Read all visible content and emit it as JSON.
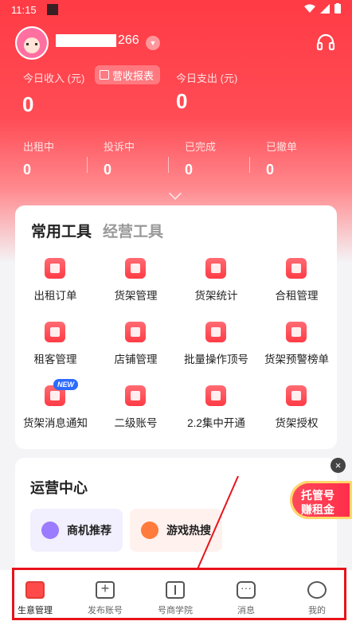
{
  "status_bar": {
    "time": "11:15"
  },
  "user": {
    "name_suffix": "266"
  },
  "income": {
    "today_income_label": "今日收入 (元)",
    "today_income_value": "0",
    "report_button": "营收报表",
    "today_expense_label": "今日支出 (元)",
    "today_expense_value": "0"
  },
  "stats": [
    {
      "label": "出租中",
      "value": "0"
    },
    {
      "label": "投诉中",
      "value": "0"
    },
    {
      "label": "已完成",
      "value": "0"
    },
    {
      "label": "已撤单",
      "value": "0"
    }
  ],
  "tools": {
    "tab_active": "常用工具",
    "tab_inactive": "经营工具",
    "items": [
      {
        "label": "出租订单"
      },
      {
        "label": "货架管理"
      },
      {
        "label": "货架统计"
      },
      {
        "label": "合租管理"
      },
      {
        "label": "租客管理"
      },
      {
        "label": "店铺管理"
      },
      {
        "label": "批量操作顶号"
      },
      {
        "label": "货架预警榜单"
      },
      {
        "label": "货架消息通知",
        "badge": "NEW"
      },
      {
        "label": "二级账号"
      },
      {
        "label": "2.2集中开通"
      },
      {
        "label": "货架授权"
      }
    ]
  },
  "ops": {
    "title": "运营中心",
    "chips": [
      {
        "label": "商机推荐"
      },
      {
        "label": "游戏热搜"
      }
    ]
  },
  "promo": {
    "line1": "托管号",
    "line2": "赚租金"
  },
  "nav": [
    {
      "label": "生意管理"
    },
    {
      "label": "发布账号"
    },
    {
      "label": "号商学院"
    },
    {
      "label": "消息"
    },
    {
      "label": "我的"
    }
  ]
}
